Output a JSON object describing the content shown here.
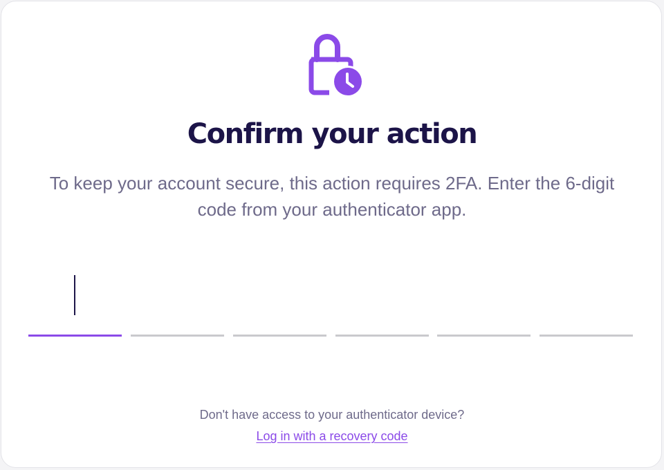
{
  "icon": "lock-clock-icon",
  "title": "Confirm your action",
  "description": "To keep your account secure, this action requires 2FA. Enter the 6-digit code from your authenticator app.",
  "otp": {
    "length": 6,
    "digits": [
      "",
      "",
      "",
      "",
      "",
      ""
    ],
    "active_index": 0
  },
  "help_text": "Don't have access to your authenticator device?",
  "recovery_link": "Log in with a recovery code",
  "colors": {
    "accent": "#8b4ae8",
    "title": "#1c1448",
    "body_text": "#6e6a8a",
    "inactive_underline": "#c9c9cd"
  }
}
